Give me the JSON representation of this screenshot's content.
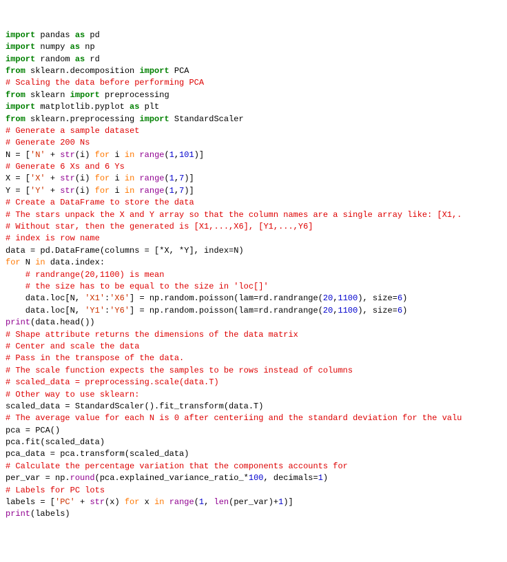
{
  "l1": {
    "t1": "import",
    "t2": " pandas ",
    "t3": "as",
    "t4": " pd"
  },
  "l2": {
    "t1": "import",
    "t2": " numpy ",
    "t3": "as",
    "t4": " np"
  },
  "l3": {
    "t1": "import",
    "t2": " random ",
    "t3": "as",
    "t4": " rd"
  },
  "l4": {
    "t1": "from",
    "t2": " sklearn.decomposition ",
    "t3": "import",
    "t4": " PCA"
  },
  "l5": "# Scaling the data before performing PCA",
  "l6": {
    "t1": "from",
    "t2": " sklearn ",
    "t3": "import",
    "t4": " preprocessing"
  },
  "l7": {
    "t1": "import",
    "t2": " matplotlib.pyplot ",
    "t3": "as",
    "t4": " plt"
  },
  "l8": {
    "t1": "from",
    "t2": " sklearn.preprocessing ",
    "t3": "import",
    "t4": " StandardScaler"
  },
  "l9": "",
  "l10": "",
  "l11": "# Generate a sample dataset",
  "l12": "# Generate 200 Ns",
  "l13": {
    "a": "N = [",
    "b": "'N'",
    "c": " + ",
    "d": "str",
    "e": "(i) ",
    "f": "for",
    "g": " i ",
    "h": "in",
    "i": " ",
    "j": "range",
    "k": "(",
    "n1": "1",
    "l": ",",
    "n2": "101",
    "m": ")]"
  },
  "l14": "# Generate 6 Xs and 6 Ys",
  "l15": {
    "a": "X = [",
    "b": "'X'",
    "c": " + ",
    "d": "str",
    "e": "(i) ",
    "f": "for",
    "g": " i ",
    "h": "in",
    "i": " ",
    "j": "range",
    "k": "(",
    "n1": "1",
    "l": ",",
    "n2": "7",
    "m": ")]"
  },
  "l16": {
    "a": "Y = [",
    "b": "'Y'",
    "c": " + ",
    "d": "str",
    "e": "(i) ",
    "f": "for",
    "g": " i ",
    "h": "in",
    "i": " ",
    "j": "range",
    "k": "(",
    "n1": "1",
    "l": ",",
    "n2": "7",
    "m": ")]"
  },
  "l17": "# Create a DataFrame to store the data",
  "l18": "# The stars unpack the X and Y array so that the column names are a single array like: [X1,.",
  "l19": "# Without star, then the generated is [X1,...,X6], [Y1,...,Y6]",
  "l20": "# index is row name",
  "l21": "data = pd.DataFrame(columns = [*X, *Y], index=N)",
  "l22": "",
  "l23": {
    "a": "for",
    "b": " N ",
    "c": "in",
    "d": " data.index:"
  },
  "l24": "    # randrange(20,1100) is mean",
  "l25": "    # the size has to be equal to the size in 'loc[]'",
  "l26": {
    "a": "    data.loc[N, ",
    "b": "'X1'",
    "c": ":",
    "d": "'X6'",
    "e": "] = np.random.poisson(lam=rd.randrange(",
    "n1": "20",
    "f": ",",
    "n2": "1100",
    "g": "), size=",
    "n3": "6",
    "h": ")"
  },
  "l27": {
    "a": "    data.loc[N, ",
    "b": "'Y1'",
    "c": ":",
    "d": "'Y6'",
    "e": "] = np.random.poisson(lam=rd.randrange(",
    "n1": "20",
    "f": ",",
    "n2": "1100",
    "g": "), size=",
    "n3": "6",
    "h": ")"
  },
  "l28": "",
  "l29": {
    "a": "print",
    "b": "(data.head())"
  },
  "l30": "# Shape attribute returns the dimensions of the data matrix",
  "l31": "# Center and scale the data",
  "l32": "# Pass in the transpose of the data.",
  "l33": "# The scale function expects the samples to be rows instead of columns",
  "l34": "# scaled_data = preprocessing.scale(data.T)",
  "l35": "# Other way to use sklearn:",
  "l36": "scaled_data = StandardScaler().fit_transform(data.T)",
  "l37": "# The average value for each N is 0 after centeriing and the standard deviation for the valu",
  "l38": "",
  "l39": "pca = PCA()",
  "l40": "pca.fit(scaled_data)",
  "l41": "pca_data = pca.transform(scaled_data)",
  "l42": "",
  "l43": "# Calculate the percentage variation that the components accounts for",
  "l44": {
    "a": "per_var = np.",
    "b": "round",
    "c": "(pca.explained_variance_ratio_*",
    "n1": "100",
    "d": ", decimals=",
    "n2": "1",
    "e": ")"
  },
  "l45": "# Labels for PC lots",
  "l46": {
    "a": "labels = [",
    "b": "'PC'",
    "c": " + ",
    "d": "str",
    "e": "(x) ",
    "f": "for",
    "g": " x ",
    "h": "in",
    "i": " ",
    "j": "range",
    "k": "(",
    "n1": "1",
    "l": ", ",
    "m": "len",
    "n": "(per_var)+",
    "n2": "1",
    "o": ")]"
  },
  "l47": {
    "a": "print",
    "b": "(labels)"
  }
}
